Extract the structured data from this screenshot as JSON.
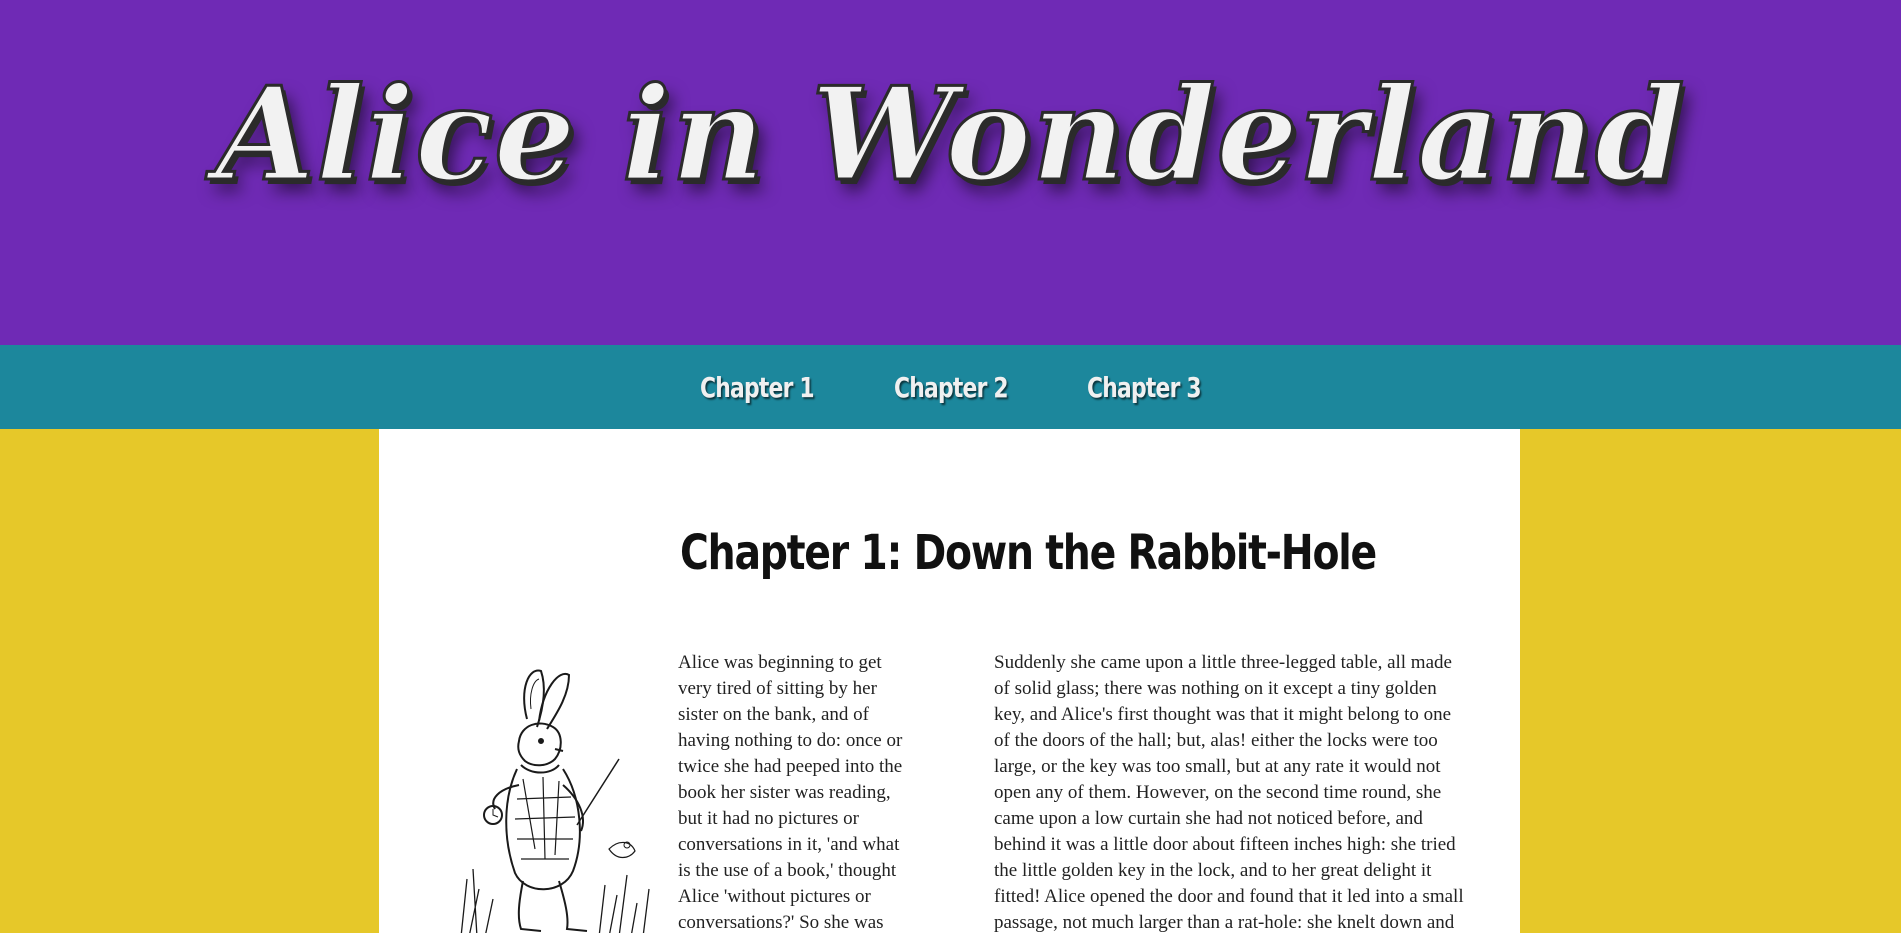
{
  "header": {
    "title": "Alice in Wonderland",
    "background": "#6f2ab5"
  },
  "nav": {
    "background": "#1c879c",
    "items": [
      {
        "label": "Chapter 1"
      },
      {
        "label": "Chapter 2"
      },
      {
        "label": "Chapter 3"
      }
    ]
  },
  "page": {
    "background": "#e6c829"
  },
  "main": {
    "chapter_title": "Chapter 1: Down the Rabbit-Hole",
    "illustration_icon": "white-rabbit-illustration",
    "column_left_text": "Alice was beginning to get very tired of sitting by her sister on the bank, and of having nothing to do: once or twice she had peeped into the book her sister was reading, but it had no pictures or conversations in it, 'and what is the use of a book,' thought Alice 'without pictures or conversations?' So she was",
    "column_right_text": "Suddenly she came upon a little three-legged table, all made of solid glass; there was nothing on it except a tiny golden key, and Alice's first thought was that it might belong to one of the doors of the hall; but, alas! either the locks were too large, or the key was too small, but at any rate it would not open any of them. However, on the second time round, she came upon a low curtain she had not noticed before, and behind it was a little door about fifteen inches high: she tried the little golden key in the lock, and to her great delight it fitted! Alice opened the door and found that it led into a small passage, not much larger than a rat-hole: she knelt down and looked"
  }
}
